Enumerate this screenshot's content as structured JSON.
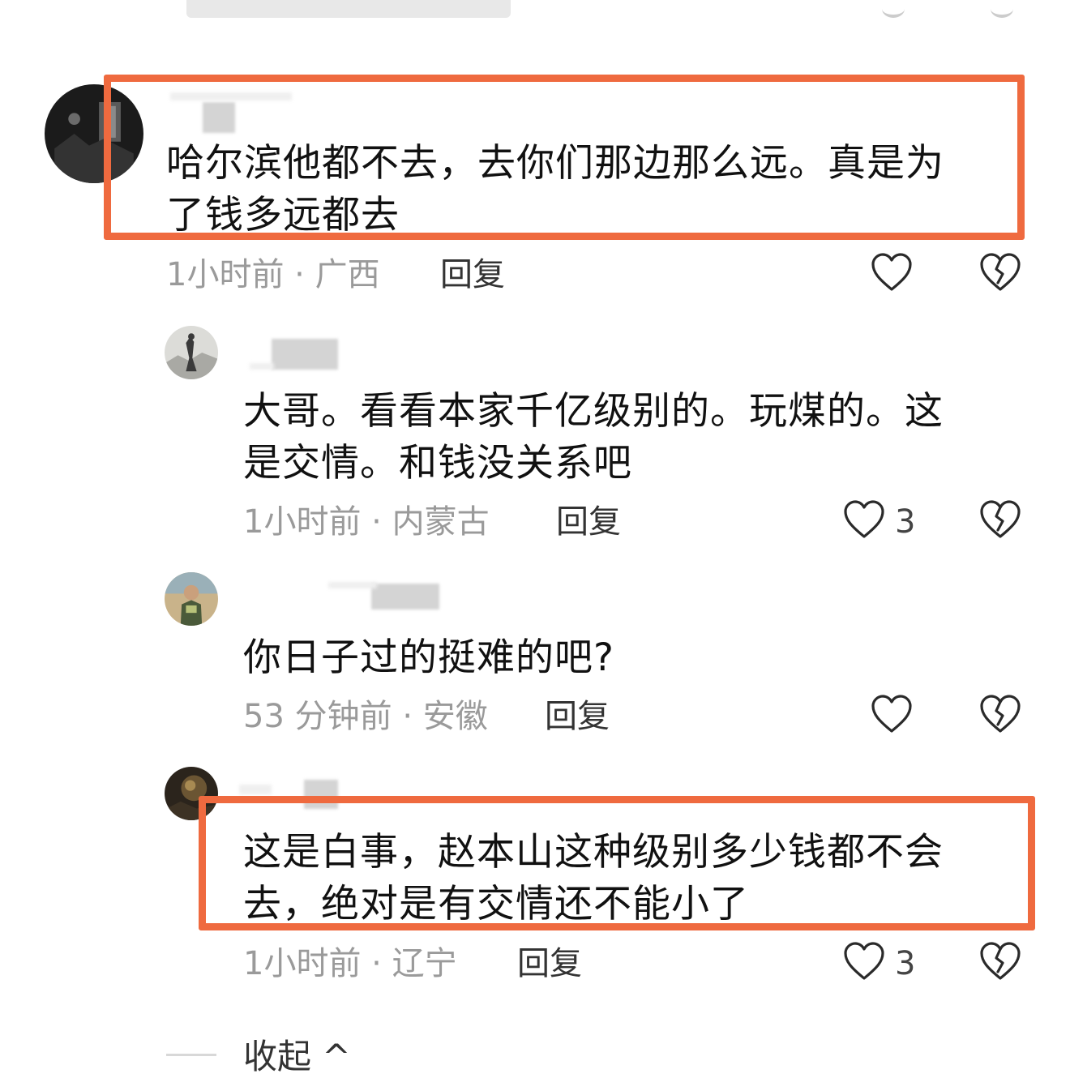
{
  "comments": [
    {
      "text": "哈尔滨他都不去，去你们那边那么远。真是为\n了钱多远都去",
      "time": "1小时前 · 广西",
      "reply_label": "回复",
      "likes": ""
    },
    {
      "text": "大哥。看看本家千亿级别的。玩煤的。这\n是交情。和钱没关系吧",
      "time": "1小时前 · 内蒙古",
      "reply_label": "回复",
      "likes": "3"
    },
    {
      "text": "你日子过的挺难的吧?",
      "time": "53 分钟前 · 安徽",
      "reply_label": "回复",
      "likes": ""
    },
    {
      "text": "这是白事，赵本山这种级别多少钱都不会\n去，绝对是有交情还不能小了",
      "time": "1小时前 · 辽宁",
      "reply_label": "回复",
      "likes": "3"
    }
  ],
  "collapse_label": "收起 ^",
  "colors": {
    "highlight": "#ef6a3f",
    "meta_text": "#9a9a9a"
  },
  "icons": {
    "like": "heart-outline-icon",
    "dislike": "broken-heart-icon",
    "collapse": "chevron-up-icon"
  }
}
